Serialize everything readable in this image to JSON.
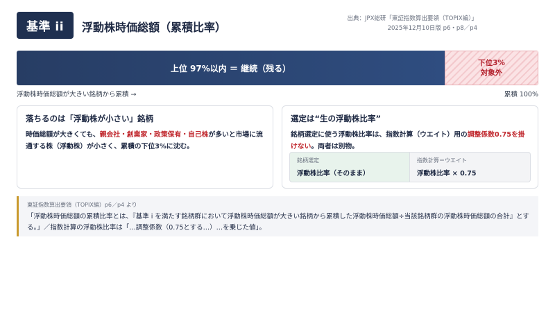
{
  "header": {
    "badge": "基準 ii",
    "title": "浮動株時価総額（累積比率）",
    "source_line1": "出典：JPX総研「東証指数算出要領（TOPIX編）」",
    "source_line2": "2025年12月10日版 p6・p8／p4"
  },
  "bar": {
    "main_label": "上位 97%以内 ＝ 継続（残る）",
    "main_percent": 97,
    "excluded_line1": "下位3%",
    "excluded_line2": "対象外",
    "axis_left": "浮動株時価総額が大きい銘柄から累積 →",
    "axis_right": "累積 100%"
  },
  "card_left": {
    "title": "落ちるのは「浮動株が小さい」銘柄",
    "body_part1": "時価総額が大きくても、",
    "body_highlight": "親会社・創業家・政策保有・自己株",
    "body_part2": "が多いと市場に流通する株（浮動株）が小さく、累積の下位3%に沈む。"
  },
  "card_right": {
    "title": "選定は“生の浮動株比率”",
    "body_part1": "銘柄選定に使う浮動株比率は、指数計算（ウエイト）用の",
    "body_highlight": "調整係数0.75を掛けない",
    "body_part2": "。両者は別物。",
    "box1_label": "銘柄選定",
    "box1_value": "浮動株比率（そのまま）",
    "box2_label": "指数計算＝ウエイト",
    "box2_value": "浮動株比率 × 0.75"
  },
  "note": {
    "source": "東証指数算出要領（TOPIX編）p6／p4 より",
    "text": "「浮動株時価総額の累積比率とは、『基準 i を満たす銘柄群において浮動株時価総額が大きい銘柄から累積した浮動株時価総額÷当該銘柄群の浮動株時価総額の合計』とする。」／指数計算の浮動株比率は「…調整係数（0.75とする…）…を乗じた値」。"
  },
  "colors": {
    "navy": "#1f3050",
    "highlight_red": "#c0272d",
    "accent_gold": "#c99a2e"
  }
}
